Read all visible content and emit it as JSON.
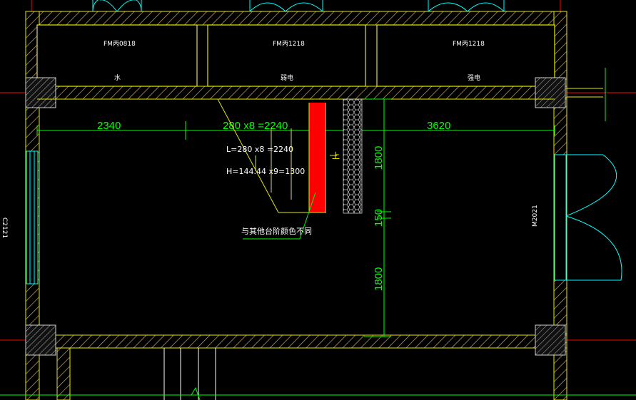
{
  "drawing": {
    "background": "#000000",
    "colors": {
      "wall": "#e8e800",
      "hatch": "#c8a86a",
      "grid": "#ff0000",
      "dim": "#00ff00",
      "door": "#00ffff",
      "white": "#ffffff",
      "stair_red": "#ff0000"
    },
    "rooms": [
      {
        "door_code": "FM丙0818",
        "name": "水"
      },
      {
        "door_code": "FM丙1218",
        "name": "弱电"
      },
      {
        "door_code": "FM丙1218",
        "name": "强电"
      }
    ],
    "window_code": "C2121",
    "door_code": "M2021",
    "dimensions": {
      "left": "2340",
      "middle": "280 x8 =2240",
      "right": "3620",
      "v_top": "1800",
      "v_mid": "150",
      "v_bot": "1800"
    },
    "stair": {
      "length_formula": "L=280 x8 =2240",
      "height_formula": "H=144.44 x9=1300",
      "up_mark": "上"
    },
    "note": "与其他台阶颜色不同"
  }
}
